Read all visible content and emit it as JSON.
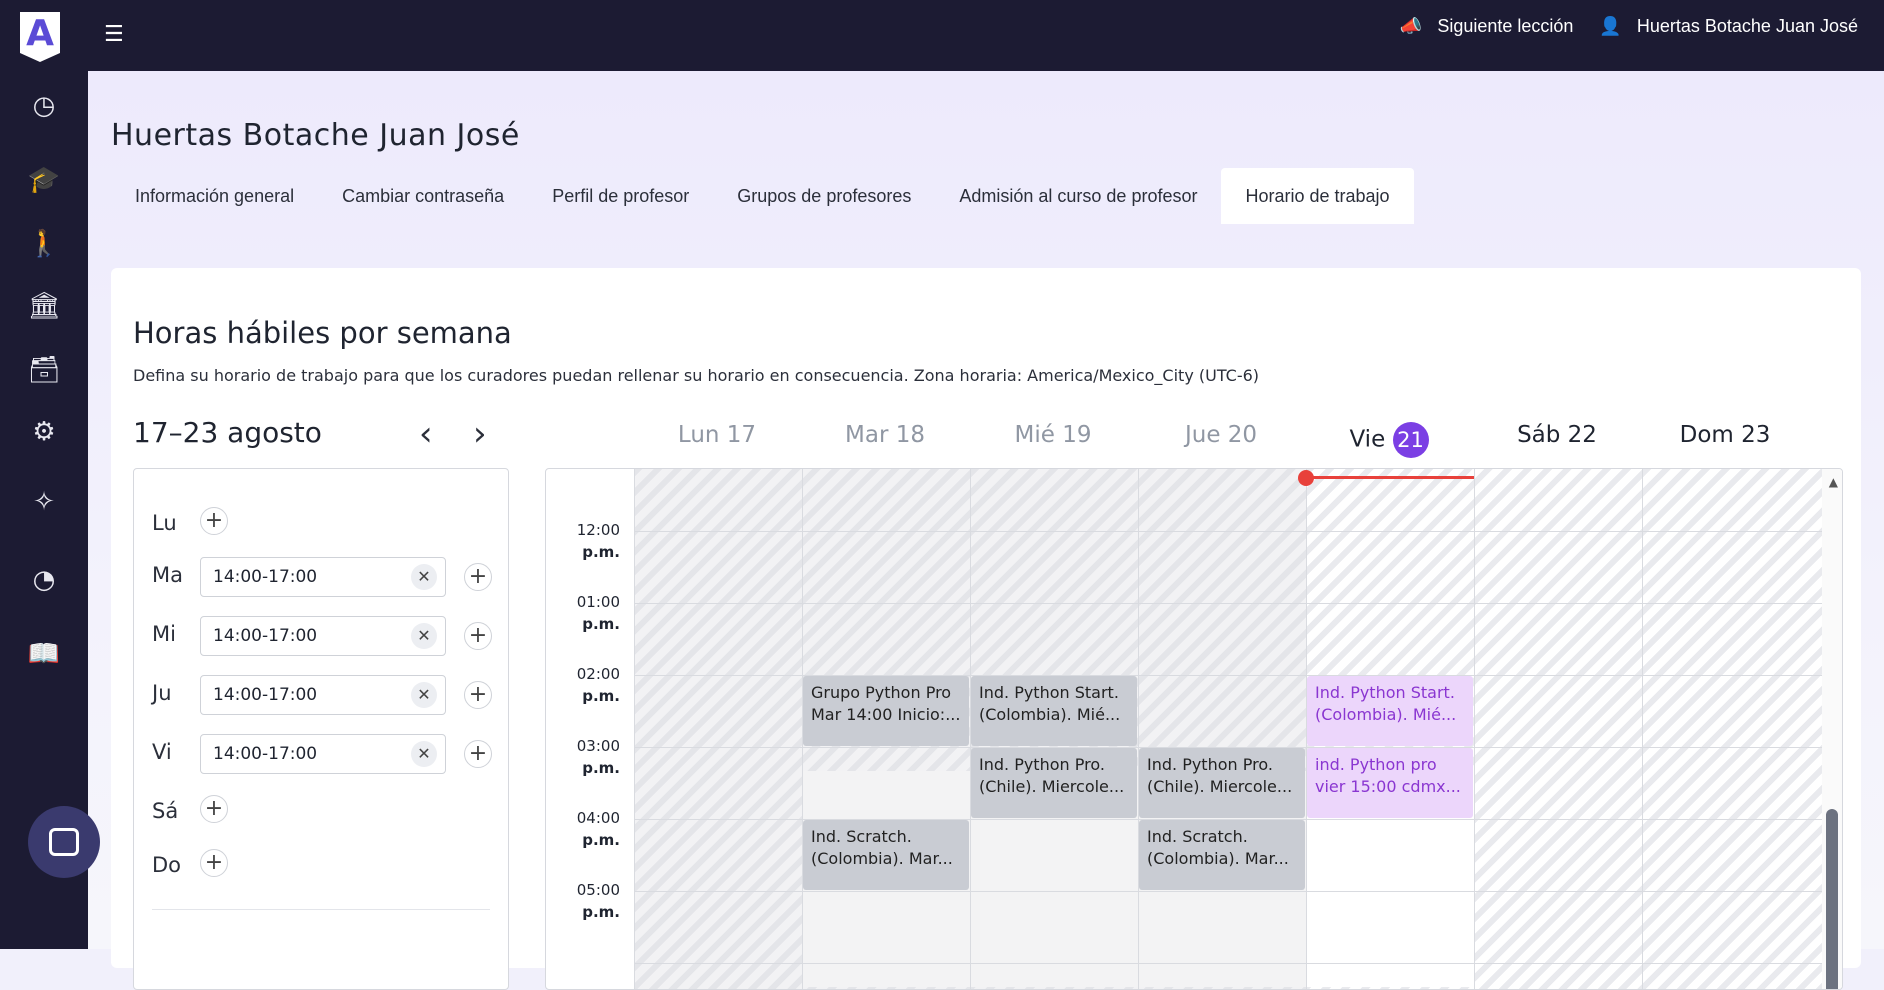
{
  "topbar": {
    "next_lesson": "Siguiente lección",
    "user_name": "Huertas Botache Juan José"
  },
  "sidebar": {
    "logo_letter": "A",
    "icons": [
      "clock-icon",
      "graduation-cap-icon",
      "student-icon",
      "building-icon",
      "archive-icon",
      "gear-icon",
      "magic-wand-icon",
      "pie-chart-icon",
      "book-icon"
    ]
  },
  "page": {
    "title": "Huertas Botache Juan José",
    "tabs": [
      {
        "label": "Información general"
      },
      {
        "label": "Cambiar contraseña"
      },
      {
        "label": "Perfil de profesor"
      },
      {
        "label": "Grupos de profesores"
      },
      {
        "label": "Admisión al curso de profesor"
      },
      {
        "label": "Horario de trabajo"
      }
    ],
    "active_tab": "Horario de trabajo"
  },
  "card": {
    "title": "Horas hábiles por semana",
    "description": "Defina su horario de trabajo para que los curadores puedan rellenar su horario en consecuencia. Zona horaria: America/Mexico_City (UTC-6)",
    "week_label": "17–23 agosto",
    "prev_arrow": "‹",
    "next_arrow": "›"
  },
  "schedule": {
    "days": [
      {
        "abbr": "Lu",
        "slots": []
      },
      {
        "abbr": "Ma",
        "slots": [
          "14:00-17:00"
        ]
      },
      {
        "abbr": "Mi",
        "slots": [
          "14:00-17:00"
        ]
      },
      {
        "abbr": "Ju",
        "slots": [
          "14:00-17:00"
        ]
      },
      {
        "abbr": "Vi",
        "slots": [
          "14:00-17:00"
        ]
      },
      {
        "abbr": "Sá",
        "slots": []
      },
      {
        "abbr": "Do",
        "slots": []
      }
    ]
  },
  "calendar": {
    "headers": [
      {
        "label": "Lun 17"
      },
      {
        "label": "Mar 18"
      },
      {
        "label": "Mié 19"
      },
      {
        "label": "Jue 20"
      },
      {
        "label": "Vie",
        "badge": "21"
      },
      {
        "label": "Sáb 22"
      },
      {
        "label": "Dom 23"
      }
    ],
    "times": [
      {
        "h": "12:00",
        "p": "p.m."
      },
      {
        "h": "01:00",
        "p": "p.m."
      },
      {
        "h": "02:00",
        "p": "p.m."
      },
      {
        "h": "03:00",
        "p": "p.m."
      },
      {
        "h": "04:00",
        "p": "p.m."
      },
      {
        "h": "05:00",
        "p": "p.m."
      }
    ],
    "events": [
      {
        "day": 1,
        "start": 2,
        "l1": "Grupo Python Pro",
        "l2": "Mar 14:00 Inicio:...",
        "style": "grey"
      },
      {
        "day": 2,
        "start": 2,
        "l1": "Ind. Python Start.",
        "l2": "(Colombia). Mié...",
        "style": "grey"
      },
      {
        "day": 2,
        "start": 3,
        "l1": "Ind. Python Pro.",
        "l2": "(Chile). Miercole...",
        "style": "grey"
      },
      {
        "day": 3,
        "start": 3,
        "l1": "Ind. Python Pro.",
        "l2": "(Chile). Miercole...",
        "style": "grey"
      },
      {
        "day": 1,
        "start": 4,
        "l1": "Ind. Scratch.",
        "l2": "(Colombia). Mar...",
        "style": "grey"
      },
      {
        "day": 3,
        "start": 4,
        "l1": "Ind. Scratch.",
        "l2": "(Colombia). Mar...",
        "style": "grey"
      },
      {
        "day": 4,
        "start": 2,
        "l1": "Ind. Python Start.",
        "l2": "(Colombia). Mié...",
        "style": "purple"
      },
      {
        "day": 4,
        "start": 3,
        "l1": "ind. Python pro",
        "l2": "vier 15:00 cdmx...",
        "style": "purple"
      }
    ]
  }
}
